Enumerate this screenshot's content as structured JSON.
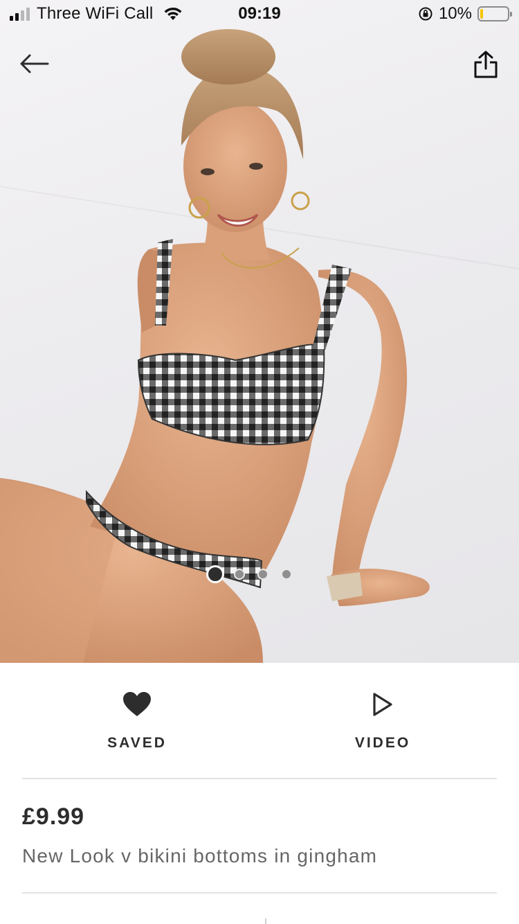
{
  "status_bar": {
    "carrier": "Three WiFi Call",
    "time": "09:19",
    "battery_percent": "10%",
    "battery_level": 0.1,
    "icons": [
      "signal-icon",
      "wifi-icon",
      "orientation-lock-icon",
      "battery-icon"
    ]
  },
  "nav": {
    "back_icon": "arrow-left-icon",
    "share_icon": "share-icon"
  },
  "gallery": {
    "image_count": 4,
    "active_index": 0
  },
  "actions": {
    "saved_label": "SAVED",
    "saved_icon": "heart-filled-icon",
    "video_label": "VIDEO",
    "video_icon": "play-outline-icon"
  },
  "product": {
    "price": "£9.99",
    "name": "New Look v bikini bottoms in gingham"
  },
  "colors": {
    "text_primary": "#2d2d2d",
    "text_secondary": "#666666",
    "battery_fill": "#f7c600",
    "divider": "#e2e2e2"
  }
}
